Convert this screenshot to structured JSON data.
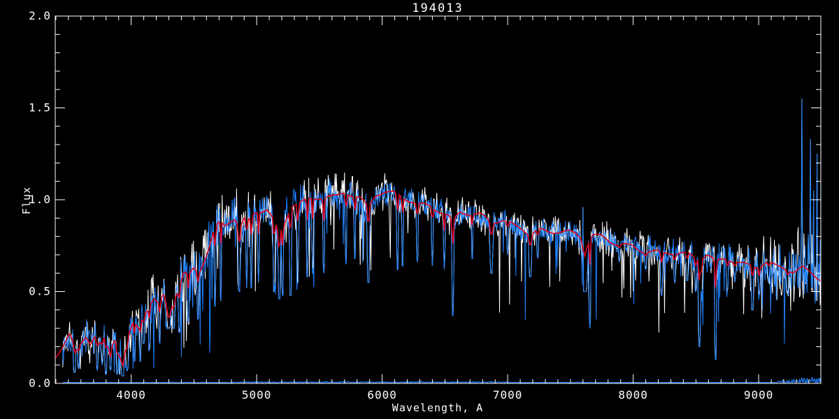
{
  "chart_data": {
    "type": "line",
    "title": "194013",
    "xlabel": "Wavelength, A",
    "ylabel": "Flux",
    "xlim": [
      3395,
      9495
    ],
    "ylim": [
      0.0,
      2.0
    ],
    "x_major_ticks": [
      4000,
      5000,
      6000,
      7000,
      8000,
      9000
    ],
    "x_tick_labels": [
      "4000",
      "5000",
      "6000",
      "7000",
      "8000",
      "9000"
    ],
    "x_minor_step": 100,
    "y_major_ticks": [
      0.0,
      0.5,
      1.0,
      1.5,
      2.0
    ],
    "y_tick_labels": [
      "0.0",
      "0.5",
      "1.0",
      "1.5",
      "2.0"
    ],
    "y_minor_step": 0.1,
    "background_color": "#000000",
    "axis_color": "#ffffff",
    "grid": false,
    "legend": "none",
    "series": [
      {
        "name": "observed-spectrum",
        "color": "#1e82ff",
        "role": "noisy-spectrum"
      },
      {
        "name": "error-envelope",
        "color": "#ffffff",
        "role": "noisy-envelope-behind"
      },
      {
        "name": "smoothed-fit",
        "color": "#e4001c",
        "role": "smooth-overlay"
      },
      {
        "name": "sky-baseline",
        "color": "#1e82ff",
        "role": "near-zero-baseline"
      }
    ],
    "data_start_wavelength": 3455,
    "continuum_points": [
      [
        3395,
        0.14
      ],
      [
        3455,
        0.2
      ],
      [
        3510,
        0.26
      ],
      [
        3560,
        0.16
      ],
      [
        3600,
        0.21
      ],
      [
        3640,
        0.26
      ],
      [
        3675,
        0.22
      ],
      [
        3710,
        0.26
      ],
      [
        3750,
        0.21
      ],
      [
        3790,
        0.25
      ],
      [
        3830,
        0.17
      ],
      [
        3870,
        0.26
      ],
      [
        3905,
        0.17
      ],
      [
        3935,
        0.13
      ],
      [
        3975,
        0.26
      ],
      [
        4020,
        0.33
      ],
      [
        4060,
        0.3
      ],
      [
        4100,
        0.38
      ],
      [
        4140,
        0.42
      ],
      [
        4180,
        0.46
      ],
      [
        4220,
        0.42
      ],
      [
        4260,
        0.47
      ],
      [
        4300,
        0.36
      ],
      [
        4340,
        0.45
      ],
      [
        4380,
        0.52
      ],
      [
        4420,
        0.6
      ],
      [
        4460,
        0.58
      ],
      [
        4500,
        0.62
      ],
      [
        4540,
        0.6
      ],
      [
        4580,
        0.67
      ],
      [
        4620,
        0.75
      ],
      [
        4660,
        0.84
      ],
      [
        4700,
        0.88
      ],
      [
        4750,
        0.86
      ],
      [
        4800,
        0.9
      ],
      [
        4830,
        0.91
      ],
      [
        4861,
        0.85
      ],
      [
        4900,
        0.9
      ],
      [
        4940,
        0.88
      ],
      [
        4980,
        0.92
      ],
      [
        5020,
        0.93
      ],
      [
        5080,
        0.95
      ],
      [
        5140,
        0.88
      ],
      [
        5175,
        0.8
      ],
      [
        5220,
        0.86
      ],
      [
        5280,
        0.97
      ],
      [
        5350,
        0.99
      ],
      [
        5420,
        1.0
      ],
      [
        5500,
        1.02
      ],
      [
        5570,
        1.03
      ],
      [
        5640,
        1.02
      ],
      [
        5700,
        1.04
      ],
      [
        5760,
        1.03
      ],
      [
        5820,
        1.01
      ],
      [
        5890,
        0.95
      ],
      [
        5950,
        1.02
      ],
      [
        6020,
        1.04
      ],
      [
        6090,
        1.03
      ],
      [
        6160,
        1.01
      ],
      [
        6230,
        1.0
      ],
      [
        6300,
        0.98
      ],
      [
        6380,
        0.97
      ],
      [
        6450,
        0.95
      ],
      [
        6520,
        0.92
      ],
      [
        6563,
        0.88
      ],
      [
        6620,
        0.93
      ],
      [
        6700,
        0.92
      ],
      [
        6780,
        0.91
      ],
      [
        6870,
        0.87
      ],
      [
        6950,
        0.89
      ],
      [
        7050,
        0.86
      ],
      [
        7120,
        0.85
      ],
      [
        7180,
        0.82
      ],
      [
        7250,
        0.84
      ],
      [
        7320,
        0.83
      ],
      [
        7400,
        0.83
      ],
      [
        7480,
        0.82
      ],
      [
        7560,
        0.8
      ],
      [
        7615,
        0.78
      ],
      [
        7680,
        0.8
      ],
      [
        7760,
        0.79
      ],
      [
        7840,
        0.77
      ],
      [
        7920,
        0.76
      ],
      [
        8000,
        0.75
      ],
      [
        8080,
        0.73
      ],
      [
        8160,
        0.72
      ],
      [
        8230,
        0.71
      ],
      [
        8300,
        0.71
      ],
      [
        8380,
        0.7
      ],
      [
        8450,
        0.69
      ],
      [
        8520,
        0.67
      ],
      [
        8590,
        0.7
      ],
      [
        8660,
        0.66
      ],
      [
        8740,
        0.69
      ],
      [
        8820,
        0.67
      ],
      [
        8900,
        0.65
      ],
      [
        8980,
        0.64
      ],
      [
        9060,
        0.66
      ],
      [
        9140,
        0.63
      ],
      [
        9220,
        0.62
      ],
      [
        9280,
        0.6
      ],
      [
        9350,
        0.62
      ],
      [
        9420,
        0.6
      ],
      [
        9495,
        0.57
      ]
    ],
    "noise_amplitude": [
      [
        3395,
        0.055
      ],
      [
        3600,
        0.06
      ],
      [
        3900,
        0.07
      ],
      [
        4100,
        0.085
      ],
      [
        4300,
        0.09
      ],
      [
        4600,
        0.09
      ],
      [
        4900,
        0.085
      ],
      [
        5200,
        0.08
      ],
      [
        5500,
        0.07
      ],
      [
        5800,
        0.065
      ],
      [
        6100,
        0.055
      ],
      [
        6400,
        0.05
      ],
      [
        6700,
        0.045
      ],
      [
        7000,
        0.045
      ],
      [
        7300,
        0.045
      ],
      [
        7600,
        0.05
      ],
      [
        7900,
        0.05
      ],
      [
        8200,
        0.055
      ],
      [
        8500,
        0.06
      ],
      [
        8800,
        0.07
      ],
      [
        9000,
        0.08
      ],
      [
        9150,
        0.09
      ],
      [
        9250,
        0.12
      ],
      [
        9350,
        0.16
      ],
      [
        9430,
        0.18
      ],
      [
        9495,
        0.2
      ]
    ],
    "downspike_regions": [
      [
        3395,
        4650,
        0.13,
        0.9
      ],
      [
        4650,
        6900,
        0.07,
        0.55
      ],
      [
        6900,
        9495,
        0.09,
        0.65
      ]
    ],
    "absorption_lines": [
      [
        3550,
        0.06,
        8
      ],
      [
        3581,
        0.08,
        6
      ],
      [
        3730,
        0.07,
        7
      ],
      [
        3770,
        0.1,
        6
      ],
      [
        3797,
        0.05,
        8
      ],
      [
        3835,
        0.07,
        7
      ],
      [
        3889,
        0.05,
        8
      ],
      [
        3933,
        0.04,
        12
      ],
      [
        3968,
        0.07,
        10
      ],
      [
        4026,
        0.12,
        6
      ],
      [
        4072,
        0.12,
        6
      ],
      [
        4101,
        0.22,
        9
      ],
      [
        4144,
        0.18,
        7
      ],
      [
        4227,
        0.22,
        7
      ],
      [
        4300,
        0.3,
        14
      ],
      [
        4340,
        0.3,
        9
      ],
      [
        4383,
        0.28,
        8
      ],
      [
        4455,
        0.33,
        7
      ],
      [
        4531,
        0.35,
        7
      ],
      [
        4668,
        0.42,
        7
      ],
      [
        4714,
        0.45,
        6
      ],
      [
        4861,
        0.5,
        9
      ],
      [
        4920,
        0.52,
        6
      ],
      [
        4957,
        0.52,
        7
      ],
      [
        5015,
        0.55,
        6
      ],
      [
        5139,
        0.5,
        8
      ],
      [
        5180,
        0.46,
        10
      ],
      [
        5206,
        0.48,
        7
      ],
      [
        5270,
        0.48,
        9
      ],
      [
        5328,
        0.55,
        7
      ],
      [
        5404,
        0.58,
        7
      ],
      [
        5446,
        0.6,
        6
      ],
      [
        5535,
        0.6,
        7
      ],
      [
        5711,
        0.65,
        6
      ],
      [
        5782,
        0.68,
        6
      ],
      [
        5890,
        0.55,
        10
      ],
      [
        6122,
        0.62,
        7
      ],
      [
        6162,
        0.64,
        6
      ],
      [
        6280,
        0.66,
        7
      ],
      [
        6400,
        0.64,
        6
      ],
      [
        6495,
        0.62,
        6
      ],
      [
        6563,
        0.37,
        8
      ],
      [
        6717,
        0.68,
        6
      ],
      [
        6870,
        0.6,
        12
      ],
      [
        7000,
        0.7,
        6
      ],
      [
        7180,
        0.58,
        12
      ],
      [
        7240,
        0.68,
        7
      ],
      [
        7615,
        0.5,
        22
      ],
      [
        7655,
        0.3,
        7
      ],
      [
        7890,
        0.66,
        6
      ],
      [
        8100,
        0.62,
        7
      ],
      [
        8227,
        0.48,
        9
      ],
      [
        8330,
        0.55,
        7
      ],
      [
        8430,
        0.56,
        8
      ],
      [
        8498,
        0.5,
        7
      ],
      [
        8528,
        0.2,
        8
      ],
      [
        8545,
        0.45,
        6
      ],
      [
        8656,
        0.13,
        8
      ],
      [
        8750,
        0.5,
        7
      ],
      [
        8810,
        0.55,
        6
      ],
      [
        8950,
        0.4,
        9
      ],
      [
        9005,
        0.48,
        7
      ],
      [
        9080,
        0.55,
        6
      ],
      [
        9230,
        0.5,
        7
      ]
    ],
    "emission_spikes": [
      [
        7600,
        0.96,
        8
      ],
      [
        9344,
        1.55,
        7
      ],
      [
        9412,
        1.33,
        7
      ],
      [
        9437,
        1.05,
        6
      ],
      [
        9465,
        1.25,
        6
      ]
    ],
    "baseline": {
      "level": 0.004,
      "start": 3455,
      "default_amp": 0.003,
      "bump_regions": [
        [
          4800,
          7000,
          0.007
        ],
        [
          9150,
          9230,
          0.015
        ],
        [
          9230,
          9495,
          0.032
        ]
      ]
    }
  }
}
